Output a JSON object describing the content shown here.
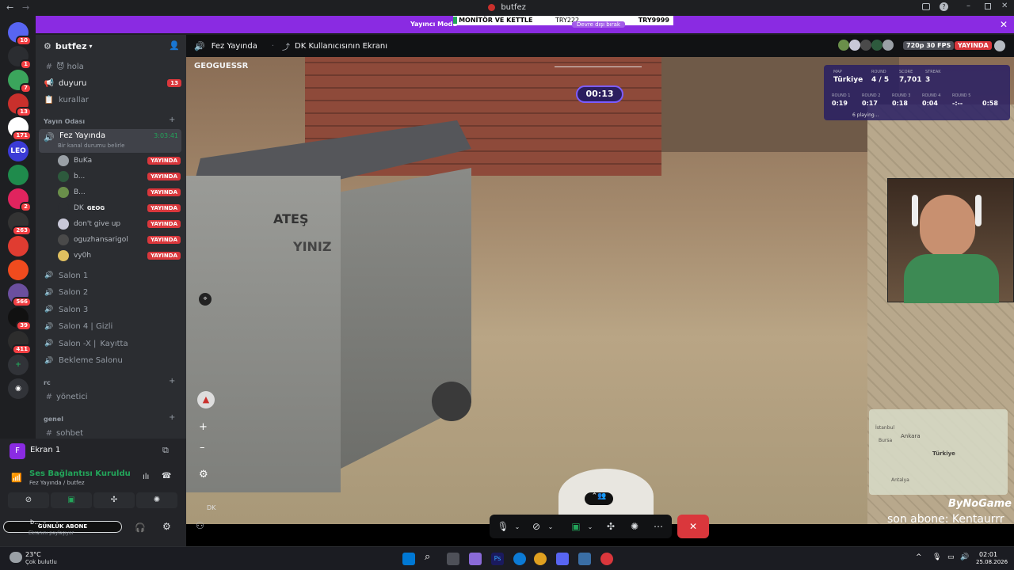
{
  "window": {
    "title": "butfez"
  },
  "promo": {
    "text": "Yayıncı Modu",
    "banner_item": "MONİTÖR VE KETTLE",
    "banner_price_1": "TRY222",
    "banner_price_2": "TRY9999",
    "disable_label": "Devre dışı bırak"
  },
  "servers": [
    {
      "name": "discord-home",
      "badge": "10",
      "color": "#5865f2"
    },
    {
      "name": "server-1",
      "badge": "1",
      "color": "#2b2d31"
    },
    {
      "name": "server-2",
      "badge": "7",
      "color": "#3ba55c"
    },
    {
      "name": "server-3",
      "badge": "13",
      "color": "#c9302c"
    },
    {
      "name": "server-4",
      "badge": "171",
      "color": "#ffffff"
    },
    {
      "name": "server-5",
      "badge": "",
      "color": "#3b3bd6"
    },
    {
      "name": "server-6",
      "badge": "",
      "color": "#1f8b4c"
    },
    {
      "name": "server-7",
      "badge": "2",
      "color": "#e0245e"
    },
    {
      "name": "server-8",
      "badge": "263",
      "color": "#333333"
    },
    {
      "name": "server-9",
      "badge": "",
      "color": "#e03c31"
    },
    {
      "name": "server-10",
      "badge": "",
      "color": "#f04b1e"
    },
    {
      "name": "server-11",
      "badge": "566",
      "color": "#6b4f9e"
    },
    {
      "name": "server-12",
      "badge": "39",
      "color": "#111111"
    },
    {
      "name": "server-13",
      "badge": "411",
      "color": "#2d2d2d"
    }
  ],
  "leo_label": "LEO",
  "guild": {
    "name": "butfez"
  },
  "channels_top": [
    {
      "icon": "#",
      "label": "hola",
      "emoji": "😈"
    },
    {
      "icon": "📢",
      "label": "duyuru",
      "badge": "13"
    },
    {
      "icon": "📋",
      "label": "kurallar"
    }
  ],
  "category_yayin": "Yayın Odası",
  "active_voice": {
    "label": "Fez Yayında",
    "status": "Bir kanal durumu belirle",
    "time": "3:03:41"
  },
  "voice_users": [
    {
      "name": "BuKa",
      "live": "YAYINDA",
      "color": "#9aa0a6"
    },
    {
      "name": "b...",
      "live": "YAYINDA",
      "color": "#2d5a3d"
    },
    {
      "name": "B...",
      "live": "YAYINDA",
      "color": "#6a8f4a"
    },
    {
      "name": "DK",
      "tag": "GEOG",
      "live": "YAYINDA",
      "color": "#2b2d31"
    },
    {
      "name": "don't give up",
      "live": "YAYINDA",
      "color": "#c8c8d8"
    },
    {
      "name": "oguzhansarigol",
      "live": "YAYINDA",
      "color": "#4a4a4a"
    },
    {
      "name": "vy0h",
      "live": "YAYINDA",
      "color": "#e0c060"
    }
  ],
  "salons": [
    {
      "label": "Salon 1"
    },
    {
      "label": "Salon 2"
    },
    {
      "label": "Salon 3"
    },
    {
      "label": "Salon 4 | Gizli"
    },
    {
      "label": "Salon -X |"
    },
    {
      "label": "Bekleme Salonu"
    }
  ],
  "kayitta": "Kayıtta",
  "category_rc": "rc",
  "yonetici": "yönetici",
  "category_genel": "genel",
  "sohbet": "sohbet",
  "screen_panel": {
    "label": "Ekran 1"
  },
  "voice_status": {
    "title": "Ses Bağlantısı Kuruldu",
    "sub": "Fez Yayında / butfez"
  },
  "user": {
    "name": "b...",
    "status": "Ekranını paylaşıyor",
    "overlay": "GÜNLÜK ABONE"
  },
  "stage": {
    "channel": "Fez Yayında",
    "screen": "DK Kullanıcısının Ekranı",
    "quality": "720p 30 FPS",
    "live": "YAYINDA",
    "geoguessr": "GEOGUESSR",
    "timer": "00:13",
    "map_label": "MAP",
    "map": "Türkiye",
    "round_label": "ROUND",
    "round": "4 / 5",
    "score_label": "SCORE",
    "score": "7,701",
    "streak_label": "STREAK",
    "streak": "3",
    "rounds": [
      {
        "label": "ROUND 1",
        "time": "0:19"
      },
      {
        "label": "ROUND 2",
        "time": "0:17"
      },
      {
        "label": "ROUND 3",
        "time": "0:18"
      },
      {
        "label": "ROUND 4",
        "time": "0:04"
      },
      {
        "label": "ROUND 5",
        "time": "-:--"
      },
      {
        "label": "",
        "time": "0:58"
      }
    ],
    "playing": "6 playing...",
    "bin_text_1": "ATEŞ",
    "bin_text_2": "YINIZ",
    "minimap_1": "Ankara",
    "minimap_2": "Türkiye",
    "minimap_3": "Antalya",
    "minimap_4": "Bursa",
    "minimap_5": "İstanbul",
    "sponsor": "ByNoGame",
    "ticker": "son abone: Kentaurrr",
    "dk_label": "DK"
  },
  "taskbar": {
    "weather": "23°C",
    "weather_sub": "Çok bulutlu",
    "time": "02:01",
    "date": "25.08.2026"
  },
  "colors": {
    "accent": "#5865f2",
    "live": "#da373c",
    "purple": "#8a2be2",
    "green": "#23a55a"
  }
}
